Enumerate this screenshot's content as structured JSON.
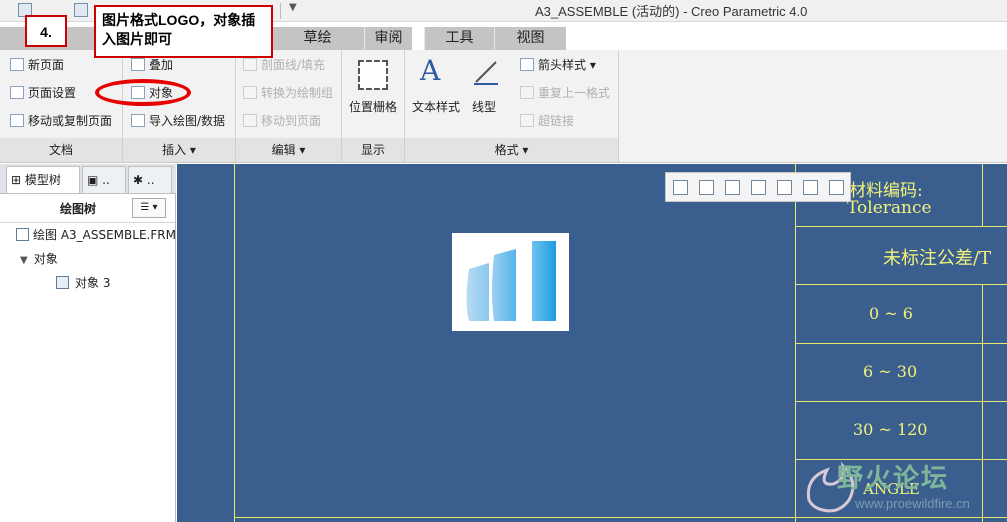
{
  "window": {
    "title": "A3_ASSEMBLE (活动的) - Creo Parametric 4.0"
  },
  "tabs": [
    "草绘",
    "审阅",
    "工具",
    "视图"
  ],
  "ribbon": {
    "doc_group": {
      "label": "文档",
      "items": [
        "新页面",
        "页面设置",
        "移动或复制页面"
      ]
    },
    "insert_group": {
      "label": "插入",
      "items": [
        "叠加",
        "对象",
        "导入绘图/数据"
      ]
    },
    "edit_group": {
      "label": "编辑",
      "items": [
        "剖面线/填充",
        "转换为绘制组",
        "移动到页面"
      ]
    },
    "display_group": {
      "label": "显示",
      "big_label": "位置栅格"
    },
    "format_group": {
      "label": "格式",
      "text_style": "文本样式",
      "line_style": "线型",
      "items": [
        "箭头样式",
        "重复上一格式",
        "超链接"
      ]
    }
  },
  "left_panel": {
    "tab_model_tree": "模型树",
    "tab2": "..",
    "tab3": "..",
    "header": "绘图树",
    "tree": {
      "root": "绘图 A3_ASSEMBLE.FRM",
      "group": "对象",
      "child": "对象 3"
    }
  },
  "title_block": {
    "material_code": "材料编码:",
    "tolerance": "Tolerance",
    "untoleranced": "未标注公差/T",
    "rows": [
      "0 ~ 6",
      "6 ~ 30",
      "30 ~ 120"
    ],
    "angle": "ANGLE"
  },
  "callout": {
    "step": "4.",
    "note": "图片格式LOGO，对象插入图片即可"
  },
  "watermark": {
    "text": "野火论坛",
    "url": "www.proewildfire.cn"
  },
  "colors": {
    "graphics_bg": "#3a5f8f",
    "table_line": "#e8e86a",
    "callout_border": "#cc0000"
  }
}
